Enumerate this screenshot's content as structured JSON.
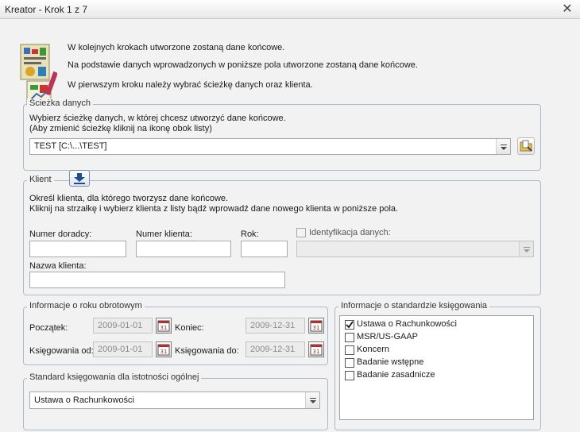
{
  "window": {
    "title": "Kreator - Krok 1 z 7",
    "close_glyph": "✕"
  },
  "intro": {
    "line1": "W kolejnych krokach utworzone zostaną dane końcowe.",
    "line2": "Na podstawie danych wprowadzonych w poniższe pola utworzone zostaną dane końcowe.",
    "line3": "W pierwszym kroku należy wybrać ścieżkę danych oraz klienta."
  },
  "path_group": {
    "legend": "Ścieżka danych",
    "desc1": "Wybierz ścieżkę danych, w której chcesz utworzyć dane końcowe.",
    "desc2": "(Aby zmienić ścieżkę kliknij na ikonę obok listy)",
    "selected": "TEST [C:\\...\\TEST]",
    "browse_icon": "folder-browse-icon"
  },
  "client_group": {
    "legend": "Klient",
    "download_icon": "download-arrow-icon",
    "desc1": "Określ klienta, dla którego tworzysz dane końcowe.",
    "desc2": "Kliknij na strzałkę i wybierz klienta z listy bądź wprowadź dane nowego klienta w poniższe pola.",
    "advisor_label": "Numer doradcy:",
    "advisor_value": "",
    "client_no_label": "Numer klienta:",
    "client_no_value": "",
    "year_label": "Rok:",
    "year_value": "",
    "ident_label": "Identyfikacja danych:",
    "ident_checked": false,
    "ident_value": "",
    "name_label": "Nazwa klienta:",
    "name_value": ""
  },
  "fiscal_group": {
    "legend": "Informacje o roku obrotowym",
    "start_label": "Początek:",
    "start_value": "2009-01-01",
    "end_label": "Koniec:",
    "end_value": "2009-12-31",
    "post_from_label": "Księgowania od:",
    "post_from_value": "2009-01-01",
    "post_to_label": "Księgowania do:",
    "post_to_value": "2009-12-31",
    "calendar_icon": "calendar-icon",
    "calendar_day": "31"
  },
  "materiality_group": {
    "legend": "Standard księgowania dla istotności ogólnej",
    "selected": "Ustawa o Rachunkowości"
  },
  "standards_group": {
    "legend": "Informacje o standardzie księgowania",
    "items": [
      {
        "label": "Ustawa o Rachunkowości",
        "checked": true
      },
      {
        "label": "MSR/US-GAAP",
        "checked": false
      },
      {
        "label": "Koncern",
        "checked": false
      },
      {
        "label": "Badanie wstępne",
        "checked": false
      },
      {
        "label": "Badanie zasadnicze",
        "checked": false
      }
    ]
  },
  "colors": {
    "group_border": "#aeb8c8",
    "disabled_field": "#ececec",
    "download_icon_bg": "#1e4f8c"
  }
}
